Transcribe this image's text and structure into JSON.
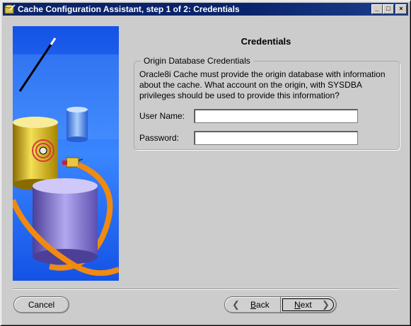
{
  "window": {
    "title": "Cache Configuration Assistant, step 1 of 2: Credentials",
    "controls": {
      "minimize": "_",
      "maximize": "□",
      "close": "×"
    }
  },
  "page": {
    "heading": "Credentials"
  },
  "origin_credentials": {
    "group_title": "Origin Database Credentials",
    "description_lines": [
      "Oracle8i Cache must provide the origin database with information",
      "about the cache.  What account on the origin, with SYSDBA",
      "privileges should be used to provide this information?"
    ],
    "user_name": {
      "label": "User Name:",
      "value": ""
    },
    "password": {
      "label": "Password:",
      "value": ""
    }
  },
  "buttons": {
    "cancel": "Cancel",
    "back_mnemonic": "B",
    "back_rest": "ack",
    "next_mnemonic": "N",
    "next_rest": "ext"
  },
  "icons": {
    "back": "chevron-left-icon",
    "next": "chevron-right-icon",
    "title": "app-icon"
  },
  "colors": {
    "title_bar": "#0a246a",
    "dialog_background": "#cccccc",
    "illustration_background": "#1e62f0"
  }
}
